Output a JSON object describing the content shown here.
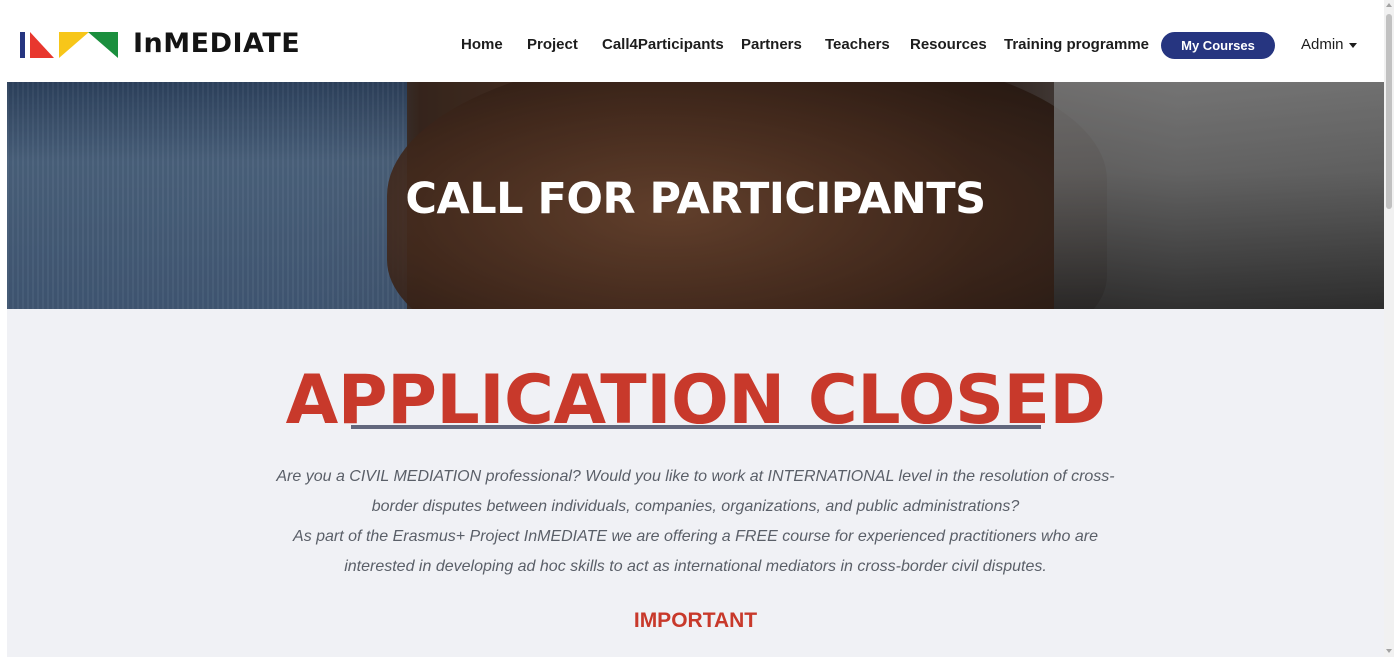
{
  "brand": {
    "name": "InMEDIATE",
    "logo_icon": "inmediate-logo-icon",
    "logo_colors": [
      "#e8372e",
      "#263580",
      "#f7c619",
      "#1b8f3e"
    ]
  },
  "nav": {
    "items": [
      "Home",
      "Project",
      "Call4Participants",
      "Partners",
      "Teachers",
      "Resources",
      "Training programme"
    ],
    "my_courses": "My Courses",
    "admin": "Admin",
    "admin_icon": "caret-down-icon"
  },
  "hero": {
    "title": "CALL FOR PARTICIPANTS",
    "image": "handshake-photo"
  },
  "main": {
    "status": "APPLICATION CLOSED",
    "intro_lines": [
      "Are you a CIVIL MEDIATION professional? Would you like to work at INTERNATIONAL level in the resolution of cross-",
      "border disputes between individuals, companies, organizations, and public administrations?",
      "As part of the Erasmus+ Project InMEDIATE we are offering a FREE course for experienced practitioners who are",
      "interested in developing ad hoc skills to act as international mediators in cross-border civil disputes."
    ],
    "important": "IMPORTANT"
  },
  "colors": {
    "accent": "#c8392b",
    "button": "#263580",
    "content_bg": "#f0f1f5",
    "underline": "#62677d"
  }
}
